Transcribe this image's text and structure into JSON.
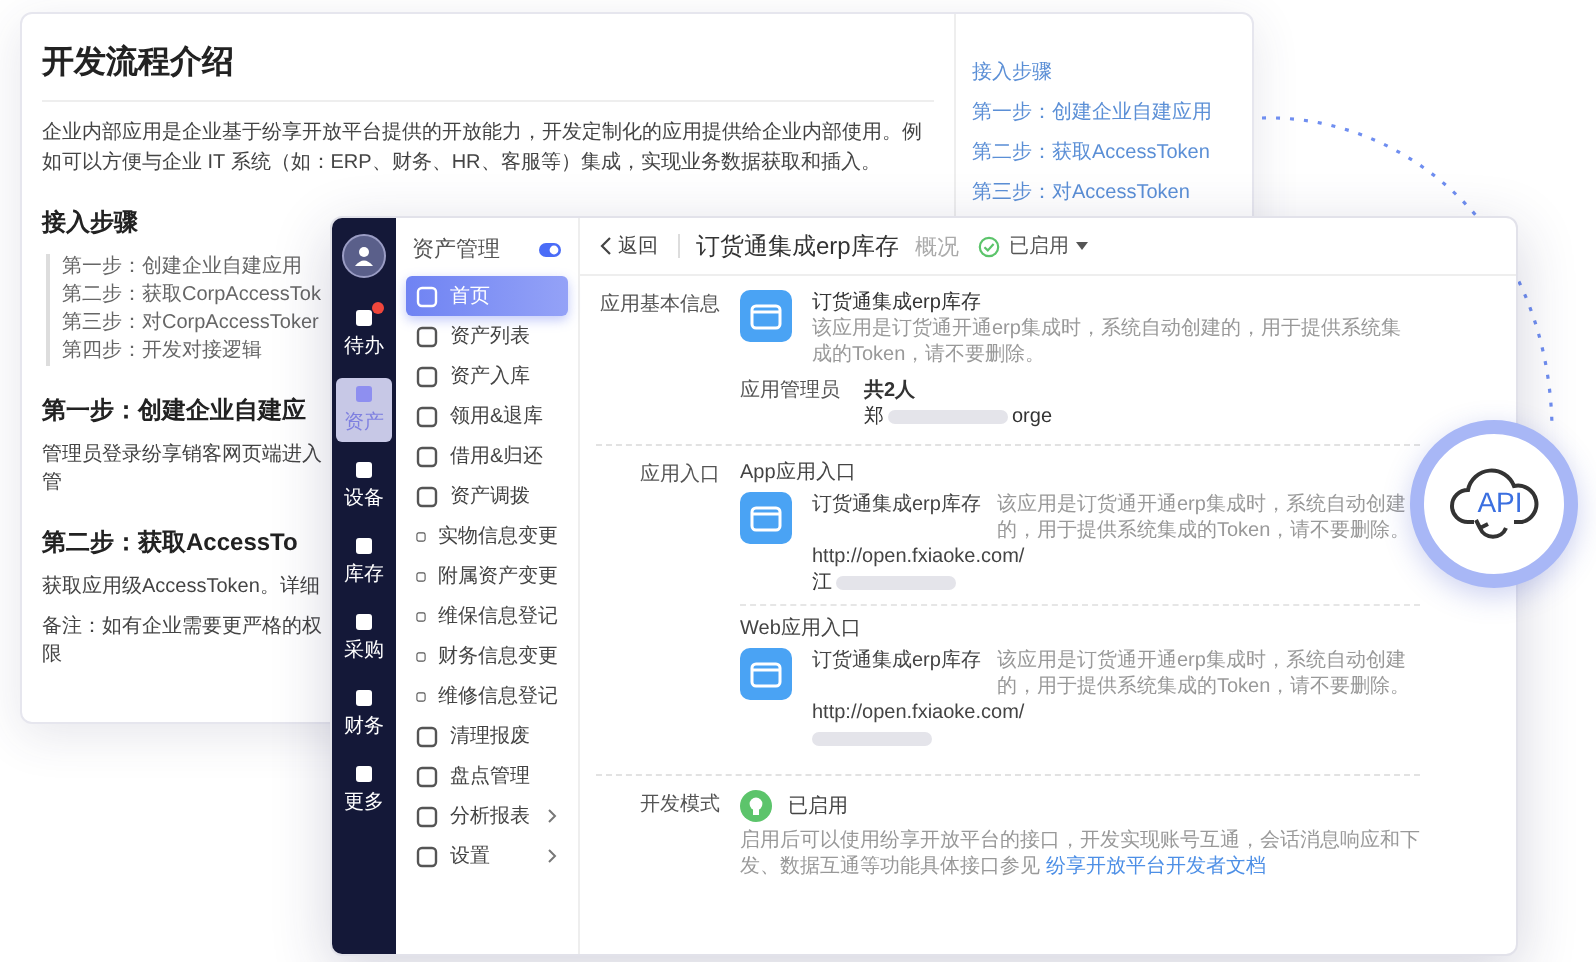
{
  "doc": {
    "title": "开发流程介绍",
    "intro": "企业内部应用是企业基于纷享开放平台提供的开放能力，开发定制化的应用提供给企业内部使用。例如可以方便与企业 IT 系统（如：ERP、财务、HR、客服等）集成，实现业务数据获取和插入。",
    "steps_heading": "接入步骤",
    "steps": [
      "第一步：创建企业自建应用",
      "第二步：获取CorpAccessTok",
      "第三步：对CorpAccessToker",
      "第四步：开发对接逻辑"
    ],
    "sections": [
      {
        "heading": "第一步：创建企业自建应",
        "paragraphs": [
          "管理员登录纷享销客网页端进入管"
        ]
      },
      {
        "heading": "第二步：获取AccessTo",
        "paragraphs": [
          "获取应用级AccessToken。详细",
          "备注：如有企业需要更严格的权限"
        ]
      }
    ],
    "toc": [
      {
        "label": "接入步骤"
      },
      {
        "label": "第一步：创建企业自建应用"
      },
      {
        "label": "第二步：获取AccessToken"
      },
      {
        "label": "第三步：对AccessToken"
      }
    ]
  },
  "app": {
    "rail": [
      {
        "label": "待办",
        "selected": false,
        "badge": true
      },
      {
        "label": "资产",
        "selected": true,
        "badge": false
      },
      {
        "label": "设备",
        "selected": false,
        "badge": false
      },
      {
        "label": "库存",
        "selected": false,
        "badge": false
      },
      {
        "label": "采购",
        "selected": false,
        "badge": false
      },
      {
        "label": "财务",
        "selected": false,
        "badge": false
      },
      {
        "label": "更多",
        "selected": false,
        "badge": false
      }
    ],
    "menu": {
      "title": "资产管理",
      "items": [
        {
          "label": "首页",
          "selected": true,
          "has_submenu": false
        },
        {
          "label": "资产列表",
          "selected": false,
          "has_submenu": false
        },
        {
          "label": "资产入库",
          "selected": false,
          "has_submenu": false
        },
        {
          "label": "领用&退库",
          "selected": false,
          "has_submenu": false
        },
        {
          "label": "借用&归还",
          "selected": false,
          "has_submenu": false
        },
        {
          "label": "资产调拨",
          "selected": false,
          "has_submenu": false
        },
        {
          "label": "实物信息变更",
          "selected": false,
          "has_submenu": false
        },
        {
          "label": "附属资产变更",
          "selected": false,
          "has_submenu": false
        },
        {
          "label": "维保信息登记",
          "selected": false,
          "has_submenu": false
        },
        {
          "label": "财务信息变更",
          "selected": false,
          "has_submenu": false
        },
        {
          "label": "维修信息登记",
          "selected": false,
          "has_submenu": false
        },
        {
          "label": "清理报废",
          "selected": false,
          "has_submenu": false
        },
        {
          "label": "盘点管理",
          "selected": false,
          "has_submenu": false
        },
        {
          "label": "分析报表",
          "selected": false,
          "has_submenu": true
        },
        {
          "label": "设置",
          "selected": false,
          "has_submenu": true
        }
      ]
    },
    "header": {
      "back": "返回",
      "title": "订货通集成erp库存",
      "tab": "概况",
      "status": "已启用"
    },
    "basic": {
      "label": "应用基本信息",
      "name": "订货通集成erp库存",
      "desc": "该应用是订货通开通erp集成时，系统自动创建的，用于提供系统集成的Token，请不要删除。",
      "admin_label": "应用管理员",
      "admin_count": "共2人",
      "admin_start": "郑",
      "admin_end": "orge"
    },
    "entry": {
      "label": "应用入口",
      "items": [
        {
          "title": "App应用入口",
          "name": "订货通集成erp库存",
          "desc": "该应用是订货通开通erp集成时，系统自动创建的，用于提供系统集成的Token，请不要删除。",
          "url": "http://open.fxiaoke.com/",
          "extra": "江"
        },
        {
          "title": "Web应用入口",
          "name": "订货通集成erp库存",
          "desc": "该应用是订货通开通erp集成时，系统自动创建的，用于提供系统集成的Token，请不要删除。",
          "url": "http://open.fxiaoke.com/"
        }
      ]
    },
    "dev": {
      "label": "开发模式",
      "status": "已启用",
      "desc": "启用后可以使用纷享开放平台的接口，开发实现账号互通，会话消息响应和下发、数据互通等功能具体接口参见",
      "link": "纷享开放平台开发者文档"
    }
  },
  "api_badge": {
    "label": "API"
  }
}
